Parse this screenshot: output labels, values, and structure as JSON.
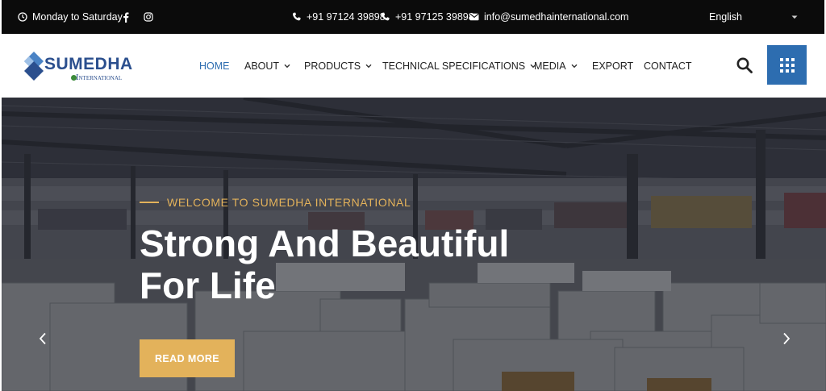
{
  "topbar": {
    "hours": "Monday to Saturday",
    "phone1": "+91 97124 39898",
    "phone2": "+91 97125 39898",
    "email": "info@sumedhainternational.com",
    "language": "English",
    "icons": [
      "clock-icon",
      "facebook-icon",
      "instagram-icon",
      "phone-icon",
      "mail-icon",
      "caret-down-icon"
    ]
  },
  "logo": {
    "main": "SUMEDHA",
    "sub": "International"
  },
  "nav": {
    "items": [
      {
        "label": "HOME"
      },
      {
        "label": "ABOUT"
      },
      {
        "label": "PRODUCTS"
      },
      {
        "label": "TECHNICAL SPECIFICATIONS"
      },
      {
        "label": "MEDIA"
      },
      {
        "label": "EXPORT"
      },
      {
        "label": "CONTACT"
      }
    ],
    "active": "HOME"
  },
  "hero": {
    "eyebrow": "WELCOME TO SUMEDHA INTERNATIONAL",
    "headline_line1": "Strong And Beautiful",
    "headline_line2": "For Life",
    "button": "READ MORE"
  },
  "colors": {
    "accent_blue": "#2d6db0",
    "accent_gold": "#e3b25b",
    "topbar_bg": "#0b0b0b",
    "logo_blue": "#2b4f8e"
  }
}
